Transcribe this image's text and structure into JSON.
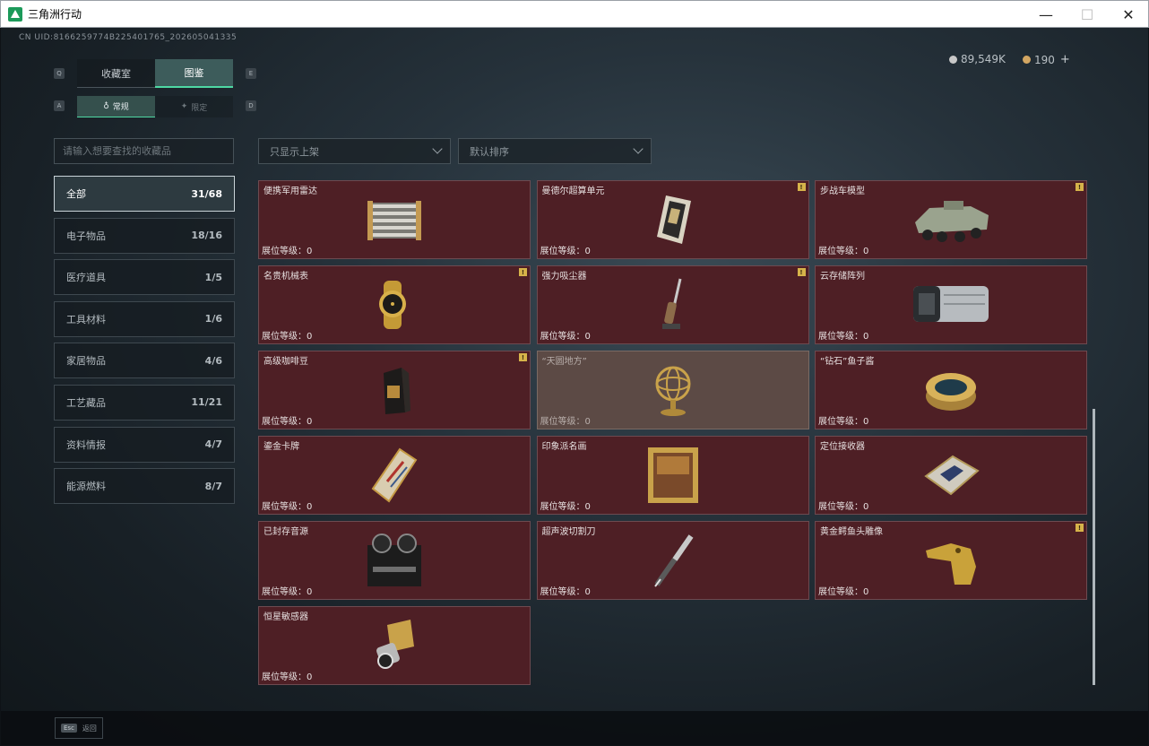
{
  "window": {
    "title": "三角洲行动",
    "minimize": "—",
    "maximize": "☐",
    "close": "✕"
  },
  "header": {
    "uid": "CN UID:8166259774B225401765_202605041335",
    "currency": [
      {
        "icon": "coin-icon",
        "value": "89,549K"
      },
      {
        "icon": "gold-coin-icon",
        "value": "190",
        "plus": "+"
      }
    ]
  },
  "key_hints": {
    "tab_left": "Q",
    "tab_right": "E",
    "sub_left": "A",
    "sub_right": "D"
  },
  "tabs": [
    {
      "label": "收藏室",
      "active": false
    },
    {
      "label": "图鉴",
      "active": true
    }
  ],
  "subtabs": [
    {
      "label": "常规",
      "glyph": "♁",
      "active": true
    },
    {
      "label": "限定",
      "glyph": "✦",
      "active": false
    }
  ],
  "search": {
    "placeholder": "请输入想要查找的收藏品"
  },
  "filters": {
    "shelf": "只显示上架",
    "sort": "默认排序"
  },
  "categories": [
    {
      "label": "全部",
      "count": "31/68",
      "active": true
    },
    {
      "label": "电子物品",
      "count": "18/16",
      "active": false
    },
    {
      "label": "医疗道具",
      "count": "1/5",
      "active": false
    },
    {
      "label": "工具材料",
      "count": "1/6",
      "active": false
    },
    {
      "label": "家居物品",
      "count": "4/6",
      "active": false
    },
    {
      "label": "工艺藏品",
      "count": "11/21",
      "active": false
    },
    {
      "label": "资料情报",
      "count": "4/7",
      "active": false
    },
    {
      "label": "能源燃料",
      "count": "8/7",
      "active": false
    }
  ],
  "items": [
    {
      "name": "便携军用雷达",
      "level": "展位等级：0",
      "badge": false,
      "icon": "radar-icon"
    },
    {
      "name": "曼德尔超算单元",
      "level": "展位等级：0",
      "badge": true,
      "icon": "chip-icon"
    },
    {
      "name": "步战车模型",
      "level": "展位等级：0",
      "badge": true,
      "icon": "apc-model-icon"
    },
    {
      "name": "名贵机械表",
      "level": "展位等级：0",
      "badge": true,
      "icon": "watch-icon"
    },
    {
      "name": "强力吸尘器",
      "level": "展位等级：0",
      "badge": true,
      "icon": "vacuum-icon"
    },
    {
      "name": "云存储阵列",
      "level": "展位等级：0",
      "badge": false,
      "icon": "storage-array-icon"
    },
    {
      "name": "高级咖啡豆",
      "level": "展位等级：0",
      "badge": true,
      "icon": "coffee-bag-icon"
    },
    {
      "name": "“天圆地方”",
      "level": "展位等级：0",
      "badge": false,
      "icon": "armillary-sphere-icon",
      "highlight": true
    },
    {
      "name": "“钻石”鱼子酱",
      "level": "展位等级：0",
      "badge": false,
      "icon": "caviar-tin-icon"
    },
    {
      "name": "鎏金卡牌",
      "level": "展位等级：0",
      "badge": false,
      "icon": "gilded-card-icon"
    },
    {
      "name": "印象派名画",
      "level": "展位等级：0",
      "badge": false,
      "icon": "painting-icon"
    },
    {
      "name": "定位接收器",
      "level": "展位等级：0",
      "badge": false,
      "icon": "receiver-icon"
    },
    {
      "name": "已封存音源",
      "level": "展位等级：0",
      "badge": false,
      "icon": "tape-recorder-icon"
    },
    {
      "name": "超声波切割刀",
      "level": "展位等级：0",
      "badge": false,
      "icon": "ultrasonic-cutter-icon"
    },
    {
      "name": "黄金鳄鱼头雕像",
      "level": "展位等级：0",
      "badge": true,
      "icon": "gold-crocodile-icon"
    },
    {
      "name": "恒星敏感器",
      "level": "展位等级：0",
      "badge": false,
      "icon": "star-sensor-icon"
    }
  ],
  "badge_glyph": "!",
  "footer": {
    "esc_key": "Esc",
    "back_label": "返回"
  }
}
